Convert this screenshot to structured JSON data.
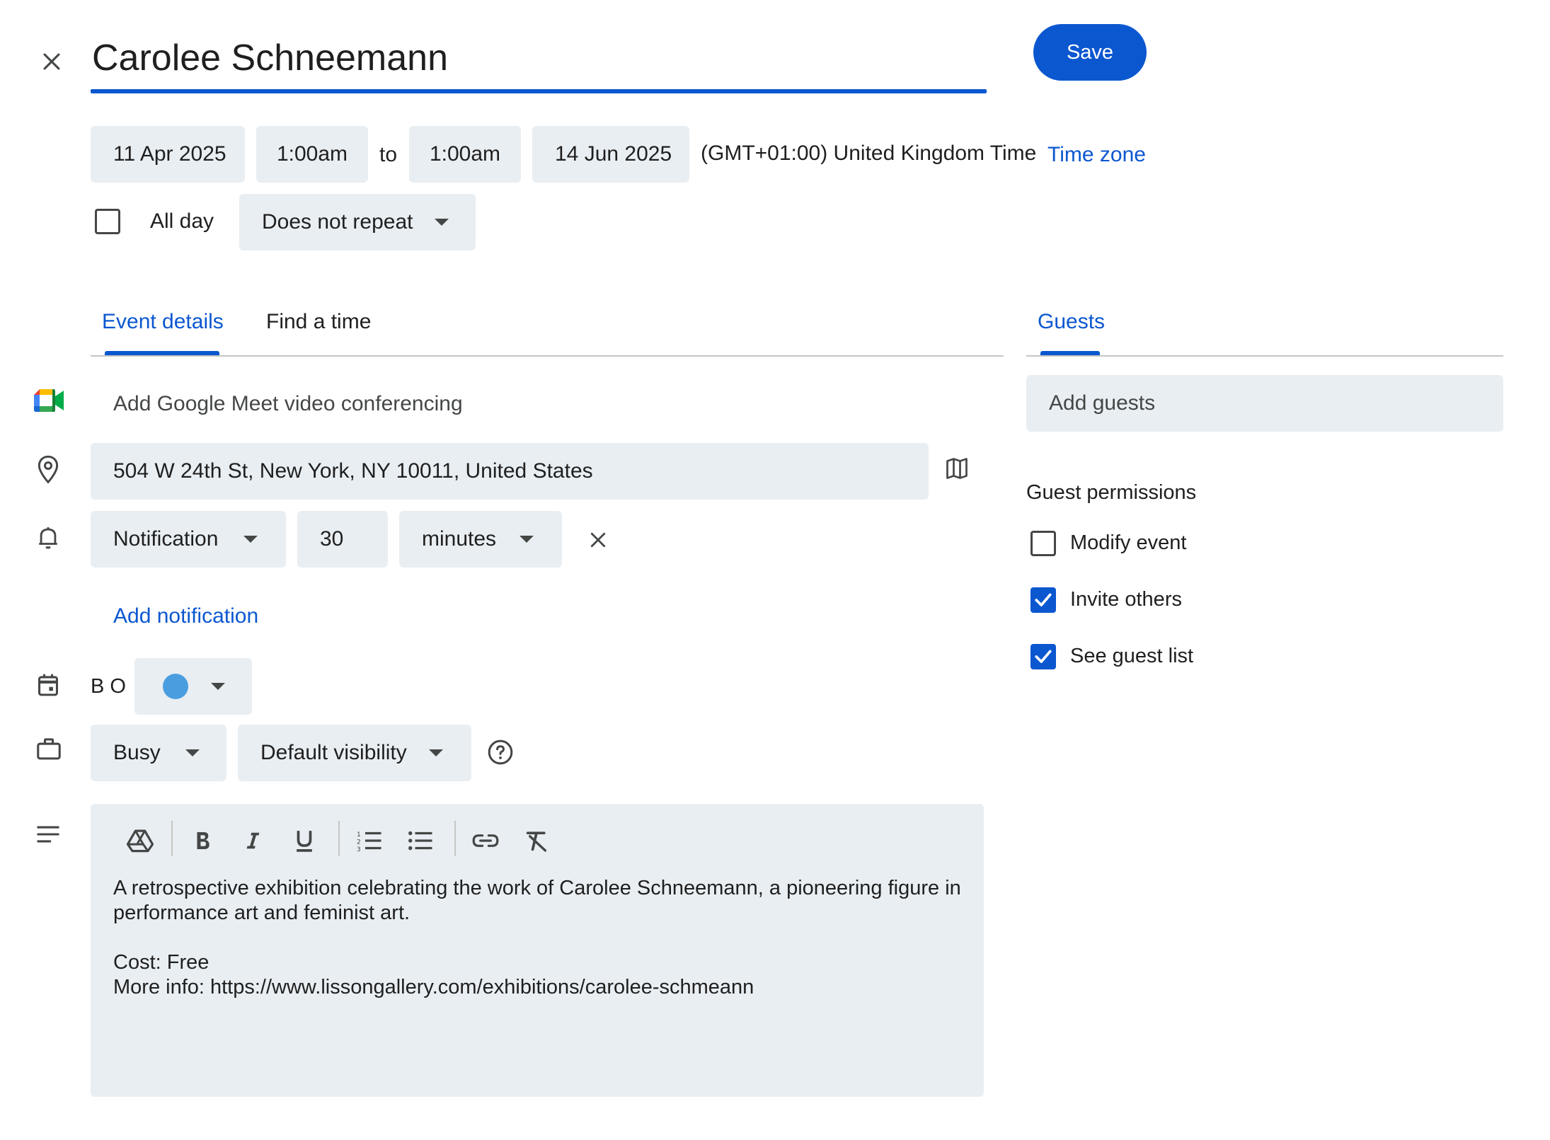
{
  "header": {
    "title": "Carolee Schneemann",
    "save_label": "Save"
  },
  "datetime": {
    "start_date": "11 Apr 2025",
    "start_time": "1:00am",
    "to_label": "to",
    "end_time": "1:00am",
    "end_date": "14 Jun 2025",
    "timezone_text": "(GMT+01:00) United Kingdom Time",
    "timezone_link": "Time zone",
    "all_day_label": "All day",
    "all_day_checked": false,
    "repeat_value": "Does not repeat"
  },
  "tabs": {
    "event_details": "Event details",
    "find_a_time": "Find a time",
    "guests": "Guests"
  },
  "details": {
    "meet_label": "Add Google Meet video conferencing",
    "location_value": "504 W 24th St, New York, NY 10011, United States",
    "notification_type": "Notification",
    "notification_amount": "30",
    "notification_unit": "minutes",
    "add_notification": "Add notification",
    "calendar_owner": "B O",
    "calendar_color": "#4a9ee0",
    "availability": "Busy",
    "visibility": "Default visibility",
    "description_line1": "A retrospective exhibition celebrating the work of Carolee Schneemann, a pioneering figure in",
    "description_line2": "performance art and feminist art.",
    "description_line3": "Cost: Free",
    "description_line4": "More info: https://www.lissongallery.com/exhibitions/carolee-schmeann"
  },
  "guests": {
    "add_guests_placeholder": "Add guests",
    "permissions_title": "Guest permissions",
    "modify_event": "Modify event",
    "modify_event_checked": false,
    "invite_others": "Invite others",
    "invite_others_checked": true,
    "see_guest_list": "See guest list",
    "see_guest_list_checked": true
  },
  "colors": {
    "accent": "#0b57d0",
    "field_bg": "#e9eef2",
    "tab_active": "#0b57d0"
  }
}
